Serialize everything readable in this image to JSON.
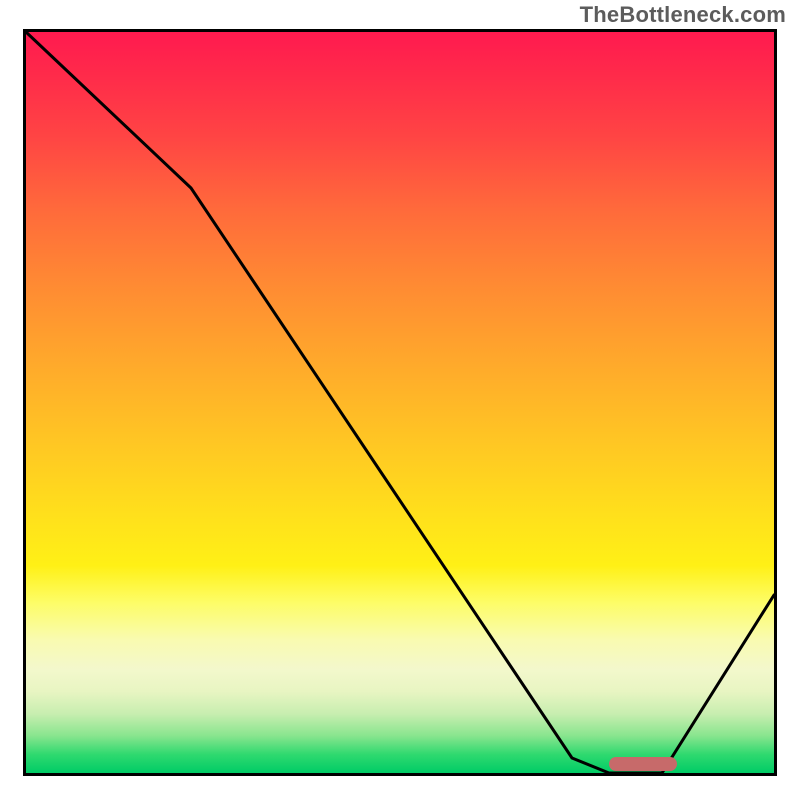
{
  "attribution": "TheBottleneck.com",
  "colors": {
    "border": "#000000",
    "curve": "#000000",
    "marker": "#c76a6a",
    "gradient_top": "#ff1a4f",
    "gradient_mid": "#ffe21b",
    "gradient_bottom": "#00cc66"
  },
  "chart_data": {
    "type": "line",
    "title": "",
    "xlabel": "",
    "ylabel": "",
    "xlim": [
      0,
      100
    ],
    "ylim": [
      0,
      100
    ],
    "grid": false,
    "series": [
      {
        "name": "bottleneck-curve",
        "x": [
          0,
          22,
          73,
          78,
          85,
          100
        ],
        "values": [
          100,
          79,
          2,
          0,
          0,
          24
        ]
      }
    ],
    "annotations": [
      {
        "name": "optimal-range",
        "x_start": 78,
        "x_end": 87,
        "y": 0
      }
    ],
    "background": "vertical-gradient red→orange→yellow→green"
  }
}
